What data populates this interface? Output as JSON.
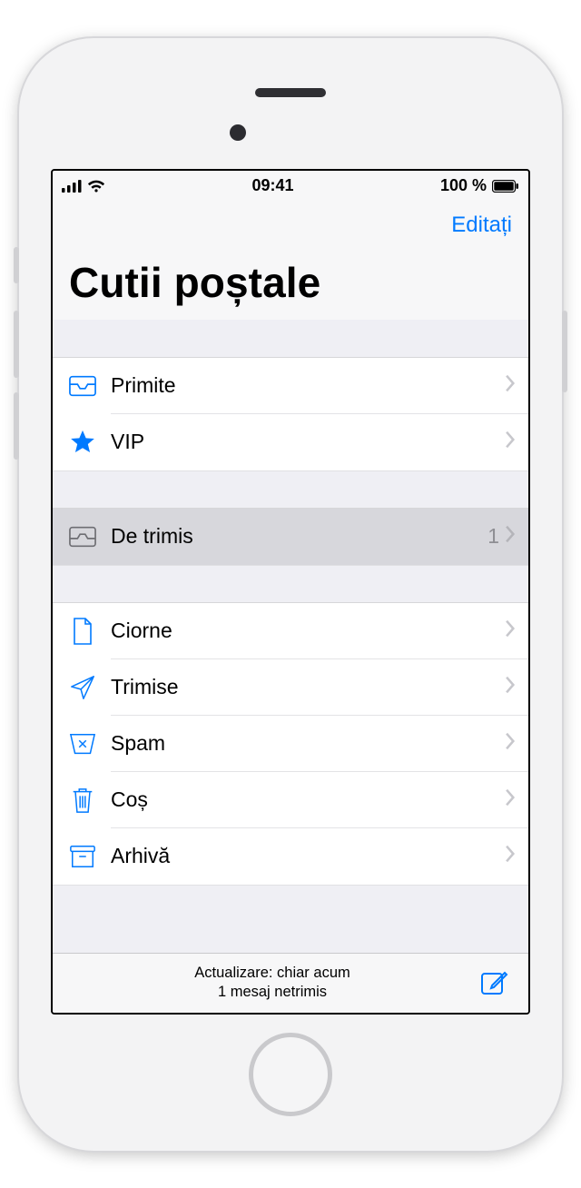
{
  "statusbar": {
    "time": "09:41",
    "battery": "100 %"
  },
  "nav": {
    "edit": "Editați",
    "title": "Cutii poștale"
  },
  "groups": {
    "g1": {
      "inbox": "Primite",
      "vip": "VIP"
    },
    "g2": {
      "outbox": "De trimis",
      "outbox_count": "1"
    },
    "g3": {
      "drafts": "Ciorne",
      "sent": "Trimise",
      "junk": "Spam",
      "trash": "Coș",
      "archive": "Arhivă"
    }
  },
  "toolbar": {
    "line1": "Actualizare: chiar acum",
    "line2": "1 mesaj netrimis"
  }
}
